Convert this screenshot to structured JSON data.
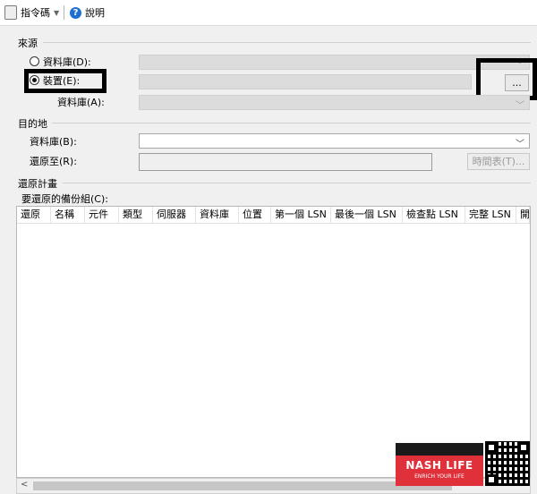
{
  "toolbar": {
    "script_label": "指令碼",
    "help_label": "說明"
  },
  "source": {
    "section_label": "來源",
    "database_radio": {
      "label": "資料庫(D):",
      "selected": false
    },
    "device_radio": {
      "label": "裝置(E):",
      "selected": true
    },
    "browse_label": "...",
    "device_database_label": "資料庫(A):"
  },
  "destination": {
    "section_label": "目的地",
    "database_label": "資料庫(B):",
    "restore_to_label": "還原至(R):",
    "timeline_label": "時間表(T)..."
  },
  "restore_plan": {
    "section_label": "還原計畫",
    "backup_sets_label": "要還原的備份組(C):",
    "columns": [
      "還原",
      "名稱",
      "元件",
      "類型",
      "伺服器",
      "資料庫",
      "位置",
      "第一個 LSN",
      "最後一個 LSN",
      "檢查點 LSN",
      "完整 LSN",
      "開"
    ]
  },
  "watermark": {
    "brand": "NASH LIFE",
    "tagline": "ENRICH YOUR LIFE"
  }
}
